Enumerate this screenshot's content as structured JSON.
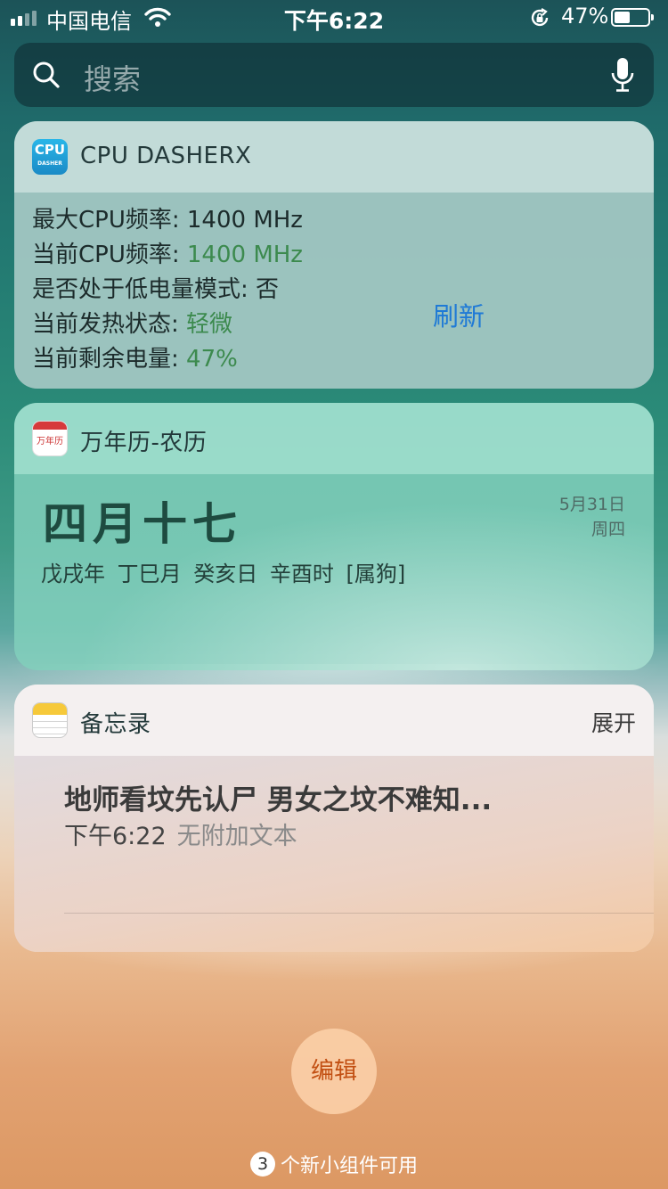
{
  "status_bar": {
    "carrier": "中国电信",
    "time": "下午6:22",
    "battery_percent_text": "47%",
    "battery_level": 0.47,
    "signal_bars": 2
  },
  "search": {
    "placeholder": "搜索",
    "icon": "search-icon",
    "mic_icon": "microphone-icon"
  },
  "widgets": {
    "cpu": {
      "title": "CPU DASHERX",
      "icon_text_main": "CPU",
      "icon_text_sub": "DASHER",
      "rows": [
        {
          "label": "最大CPU频率: ",
          "value": "1400 MHz"
        },
        {
          "label": "当前CPU频率: ",
          "value": "1400 MHz"
        },
        {
          "label": "是否处于低电量模式: ",
          "value": "否"
        },
        {
          "label": "当前发热状态: ",
          "value": "轻微"
        },
        {
          "label": "当前剩余电量: ",
          "value": "47%"
        }
      ],
      "refresh_label": "刷新",
      "value_highlight_color": "#3c8a4e",
      "link_color": "#1f7ad6"
    },
    "calendar": {
      "title": "万年历-农历",
      "icon_text": "万年历",
      "lunar_date": "四月十七",
      "gregorian_date": "5月31日",
      "weekday": "周四",
      "ganzhi": "戊戌年  丁巳月  癸亥日  辛酉时 [属狗]"
    },
    "notes": {
      "title": "备忘录",
      "expand_label": "展开",
      "note_title": "地师看坟先认尸 男女之坟不难知...",
      "note_time": "下午6:22",
      "note_subtitle": "无附加文本"
    }
  },
  "edit_button": {
    "label": "编辑",
    "color": "#c24f12"
  },
  "footer": {
    "new_widget_count": "3",
    "new_widget_text": "个新小组件可用"
  }
}
